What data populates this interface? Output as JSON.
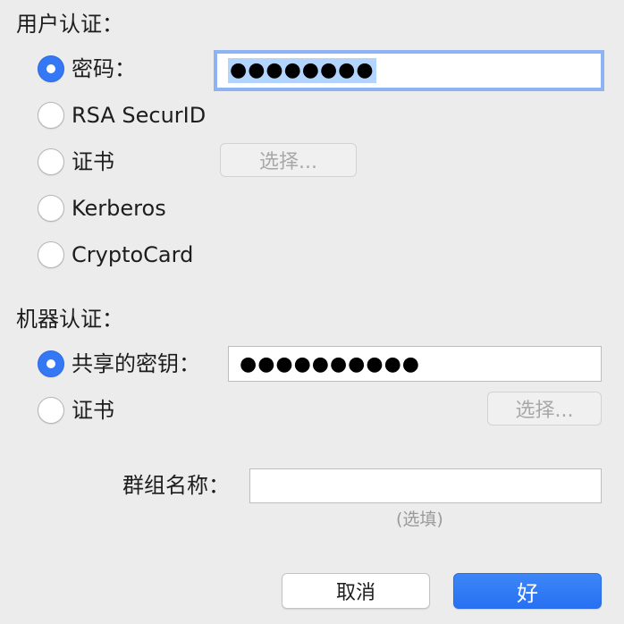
{
  "user_auth": {
    "label": "用户认证：",
    "options": [
      {
        "label": "密码：",
        "checked": true
      },
      {
        "label": "RSA SecurID",
        "checked": false
      },
      {
        "label": "证书",
        "checked": false
      },
      {
        "label": "Kerberos",
        "checked": false
      },
      {
        "label": "CryptoCard",
        "checked": false
      }
    ],
    "password_value": "●●●●●●●●",
    "choose_button": "选择..."
  },
  "machine_auth": {
    "label": "机器认证：",
    "options": [
      {
        "label": "共享的密钥：",
        "checked": true
      },
      {
        "label": "证书",
        "checked": false
      }
    ],
    "shared_secret_value": "●●●●●●●●●●",
    "choose_button": "选择..."
  },
  "group": {
    "label": "群组名称：",
    "value": "",
    "hint": "(选填)"
  },
  "buttons": {
    "cancel": "取消",
    "ok": "好"
  },
  "colors": {
    "accent": "#3478f6",
    "background": "#ececec"
  }
}
